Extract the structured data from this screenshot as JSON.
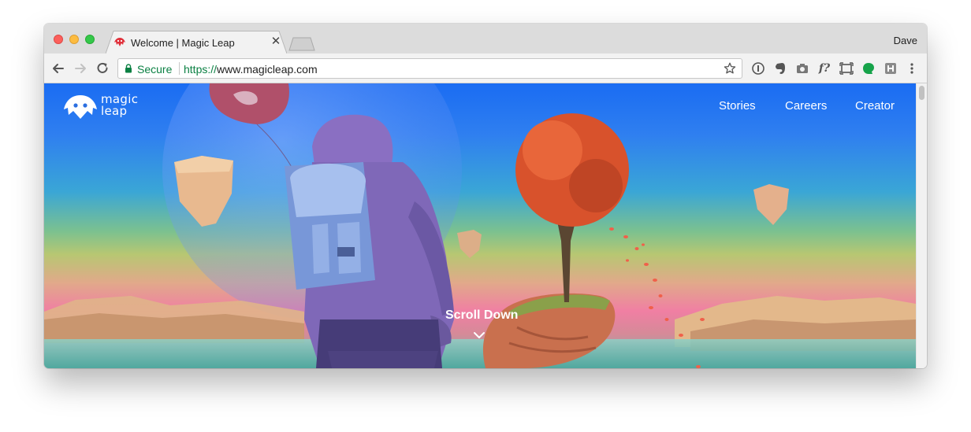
{
  "window": {
    "tab_title": "Welcome | Magic Leap",
    "tab_close": "✕",
    "profile_name": "Dave"
  },
  "toolbar": {
    "secure_label": "Secure",
    "url_scheme": "https://",
    "url_host": "www.magicleap.com"
  },
  "extensions": {
    "formula_label": "f?"
  },
  "site": {
    "logo_line1": "magic",
    "logo_line2": "leap",
    "nav": [
      "Stories",
      "Careers",
      "Creator"
    ],
    "scroll_label": "Scroll Down"
  },
  "colors": {
    "secure_green": "#0b8043",
    "sky_top": "#1a6cf2",
    "horizon_pink": "#f07fa3",
    "tree_red": "#d8522c",
    "astronaut_purple": "#8a6fc2"
  }
}
